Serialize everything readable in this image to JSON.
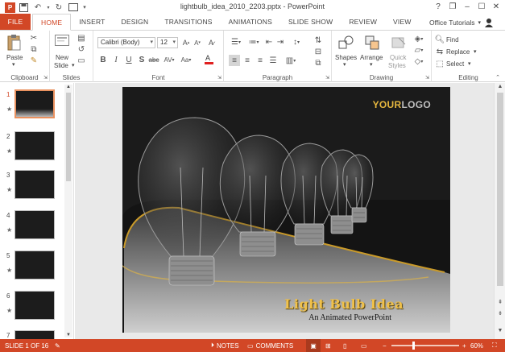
{
  "window": {
    "title": "lightbulb_idea_2010_2203.pptx - PowerPoint",
    "controls": [
      "?",
      "❐",
      "–",
      "☐",
      "✕"
    ]
  },
  "tabs": {
    "file": "FILE",
    "home": "HOME",
    "insert": "INSERT",
    "design": "DESIGN",
    "transitions": "TRANSITIONS",
    "animations": "ANIMATIONS",
    "slideshow": "SLIDE SHOW",
    "review": "REVIEW",
    "view": "VIEW"
  },
  "account": "Office Tutorials",
  "ribbon": {
    "clipboard": {
      "label": "Clipboard",
      "paste": "Paste"
    },
    "slides": {
      "label": "Slides",
      "new_slide_1": "New",
      "new_slide_2": "Slide"
    },
    "font": {
      "label": "Font",
      "name": "Calibri (Body)",
      "size": "12"
    },
    "paragraph": {
      "label": "Paragraph"
    },
    "drawing": {
      "label": "Drawing",
      "shapes": "Shapes",
      "arrange": "Arrange",
      "quick_styles_1": "Quick",
      "quick_styles_2": "Styles"
    },
    "editing": {
      "label": "Editing",
      "find": "Find",
      "replace": "Replace",
      "select": "Select"
    }
  },
  "thumbnails": [
    {
      "num": "1",
      "star": "★",
      "selected": true
    },
    {
      "num": "2",
      "star": "★",
      "selected": false
    },
    {
      "num": "3",
      "star": "★",
      "selected": false
    },
    {
      "num": "4",
      "star": "★",
      "selected": false
    },
    {
      "num": "5",
      "star": "★",
      "selected": false
    },
    {
      "num": "6",
      "star": "★",
      "selected": false
    },
    {
      "num": "7",
      "star": "",
      "selected": false
    }
  ],
  "slide": {
    "logo_a": "YOUR",
    "logo_b": "LOGO",
    "title": "Light Bulb Idea",
    "subtitle": "An Animated PowerPoint"
  },
  "status": {
    "slide_info": "SLIDE 1 OF 16",
    "notes": "NOTES",
    "comments": "COMMENTS",
    "zoom": "60%",
    "zoom_level_pct": 60
  },
  "colors": {
    "accent": "#d24726",
    "title_gold": "#f0c14a"
  }
}
